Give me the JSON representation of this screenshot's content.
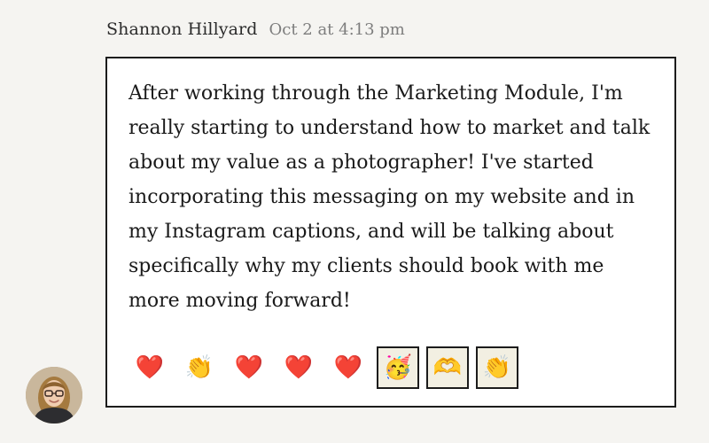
{
  "post": {
    "author_name": "Shannon Hillyard",
    "timestamp": "Oct 2 at 4:13 pm",
    "message": "After working through the Marketing Module, I'm really starting to understand how to market and talk about my value as a photographer! I've started incorporating this messaging on my website and in my Instagram captions, and will be talking about specifically why my clients should book with me more moving forward!",
    "reactions": [
      {
        "emoji": "❤️",
        "icon_name": "red-heart-icon",
        "selected": false
      },
      {
        "emoji": "👏",
        "icon_name": "clapping-hands-icon",
        "selected": false
      },
      {
        "emoji": "❤️",
        "icon_name": "red-heart-icon",
        "selected": false
      },
      {
        "emoji": "❤️",
        "icon_name": "red-heart-icon",
        "selected": false
      },
      {
        "emoji": "❤️",
        "icon_name": "red-heart-icon",
        "selected": false
      },
      {
        "emoji": "🥳",
        "icon_name": "partying-face-icon",
        "selected": true
      },
      {
        "emoji": "🫶",
        "icon_name": "heart-hands-icon",
        "selected": true
      },
      {
        "emoji": "👏",
        "icon_name": "clapping-hands-icon",
        "selected": true
      }
    ]
  },
  "colors": {
    "page_background": "#f5f4f1",
    "card_border": "#1c1c1c",
    "timestamp_text": "#7d7d7d",
    "selected_reaction_background": "#f2efe2"
  }
}
